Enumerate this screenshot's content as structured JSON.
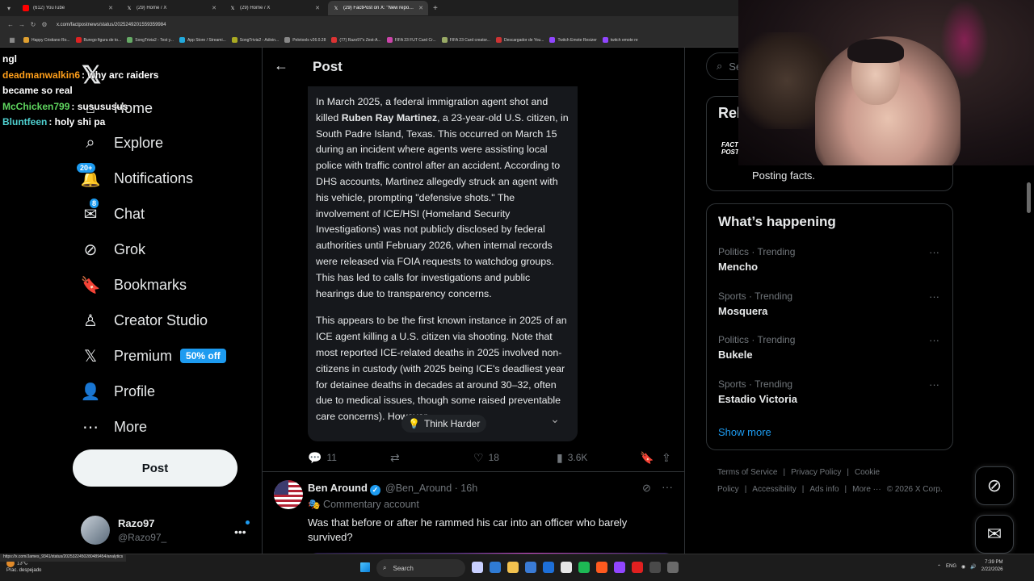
{
  "browser": {
    "tabs": [
      {
        "label": "(612) YouTube",
        "color": "#ff0000",
        "active": false
      },
      {
        "label": "(29) Home / X",
        "color": "#ffffff",
        "active": false
      },
      {
        "label": "(29) Home / X",
        "color": "#ffffff",
        "active": false
      },
      {
        "label": "(29) FactPost on X: \"New repo…",
        "color": "#ffffff",
        "active": true
      }
    ],
    "url": "x.com/factpostnews/status/2025249201559359984",
    "bookmarks": [
      "Happy Cristiano Ro...",
      "Burego figura de to...",
      "SongTrivia2 - Test y...",
      "App Store / Streami...",
      "SongTrivia2 - Adivin...",
      "Peletools v26.0.28",
      "(77) Razo97's Zest-A...",
      "FIFA 23 FUT Card Cr...",
      "FIFA 23 Card creator...",
      "Descargador de You...",
      "Twitch Emote Resizer",
      "twitch emote re"
    ],
    "status_url": "https://x.com/James_9341/status/2025322450280489454/analytics"
  },
  "chat": [
    {
      "user": "",
      "text": "ngl",
      "color": "#ffffff"
    },
    {
      "user": "deadmanwalkin6",
      "text": ": why arc raiders",
      "color": "#ff9f1a"
    },
    {
      "user": "",
      "text": "became so real",
      "color": "#ffffff"
    },
    {
      "user": "McChicken799",
      "text": ": susususus",
      "color": "#5fd65f"
    },
    {
      "user": "Bluntfeen",
      "text": ": holy shi pa",
      "color": "#4fd0d0"
    }
  ],
  "sidebar": {
    "items": [
      {
        "label": "Home",
        "icon": "home-icon"
      },
      {
        "label": "Explore",
        "icon": "search-icon"
      },
      {
        "label": "Notifications",
        "icon": "bell-icon",
        "badge": "20+"
      },
      {
        "label": "Chat",
        "icon": "mail-icon",
        "badge": "8"
      },
      {
        "label": "Grok",
        "icon": "grok-icon"
      },
      {
        "label": "Bookmarks",
        "icon": "bookmark-icon"
      },
      {
        "label": "Creator Studio",
        "icon": "creator-icon"
      },
      {
        "label": "Premium",
        "icon": "x-premium-icon",
        "promo": "50% off"
      },
      {
        "label": "Profile",
        "icon": "person-icon"
      },
      {
        "label": "More",
        "icon": "more-circle-icon"
      }
    ],
    "post_label": "Post",
    "account": {
      "name": "Razo97",
      "handle": "@Razo97_"
    }
  },
  "main": {
    "title": "Post",
    "grok": {
      "p1_pre": "In March 2025, a federal immigration agent shot and killed ",
      "p1_bold": "Ruben Ray Martinez",
      "p1_post": ", a 23-year-old U.S. citizen, in South Padre Island, Texas. This occurred on March 15 during an incident where agents were assisting local police with traffic control after an accident. According to DHS accounts, Martinez allegedly struck an agent with his vehicle, prompting \"defensive shots.\" The involvement of ICE/HSI (Homeland Security Investigations) was not publicly disclosed by federal authorities until February 2026, when internal records were released via FOIA requests to watchdog groups. This has led to calls for investigations and public hearings due to transparency concerns.",
      "p2": "This appears to be the first known instance in 2025 of an ICE agent killing a U.S. citizen via shooting. Note that most reported ICE-related deaths in 2025 involved non-citizens in custody (with 2025 being ICE's deadliest year for detainee deaths in decades at around 30–32, often due to medical issues, though some raised preventable care concerns). However,",
      "think_harder": "Think Harder"
    },
    "actions": {
      "replies": "11",
      "reposts": "",
      "likes": "18",
      "views": "3.6K"
    },
    "reply": {
      "name": "Ben Around",
      "handle": "@Ben_Around · 16h",
      "sub": "Commentary account",
      "text": "Was that before or after he rammed his car into an officer who barely survived?"
    }
  },
  "right": {
    "search_placeholder": "Se",
    "relevant_title": "Rel",
    "relevant_logo": "FACT POST",
    "relevant_bio": "Posting facts.",
    "happening_title": "What’s happening",
    "trends": [
      {
        "meta": "Politics · Trending",
        "name": "Mencho"
      },
      {
        "meta": "Sports · Trending",
        "name": "Mosquera"
      },
      {
        "meta": "Politics · Trending",
        "name": "Bukele"
      },
      {
        "meta": "Sports · Trending",
        "name": "Estadio Victoria"
      }
    ],
    "show_more": "Show more",
    "footer": [
      "Terms of Service",
      "|",
      "Privacy Policy",
      "|",
      "Cookie Policy",
      "|",
      "Accessibility",
      "|",
      "Ads info",
      "|",
      "More ···",
      "© 2026 X Corp."
    ]
  },
  "taskbar": {
    "weather_temp": "13°C",
    "weather_desc": "Prac. despejado",
    "search_label": "Search",
    "lang": "ENG",
    "time": "7:39 PM",
    "date": "2/22/2026"
  },
  "colors": {
    "accent": "#1d9bf0",
    "background": "#000000",
    "border": "#2f3336",
    "muted": "#71767b"
  }
}
